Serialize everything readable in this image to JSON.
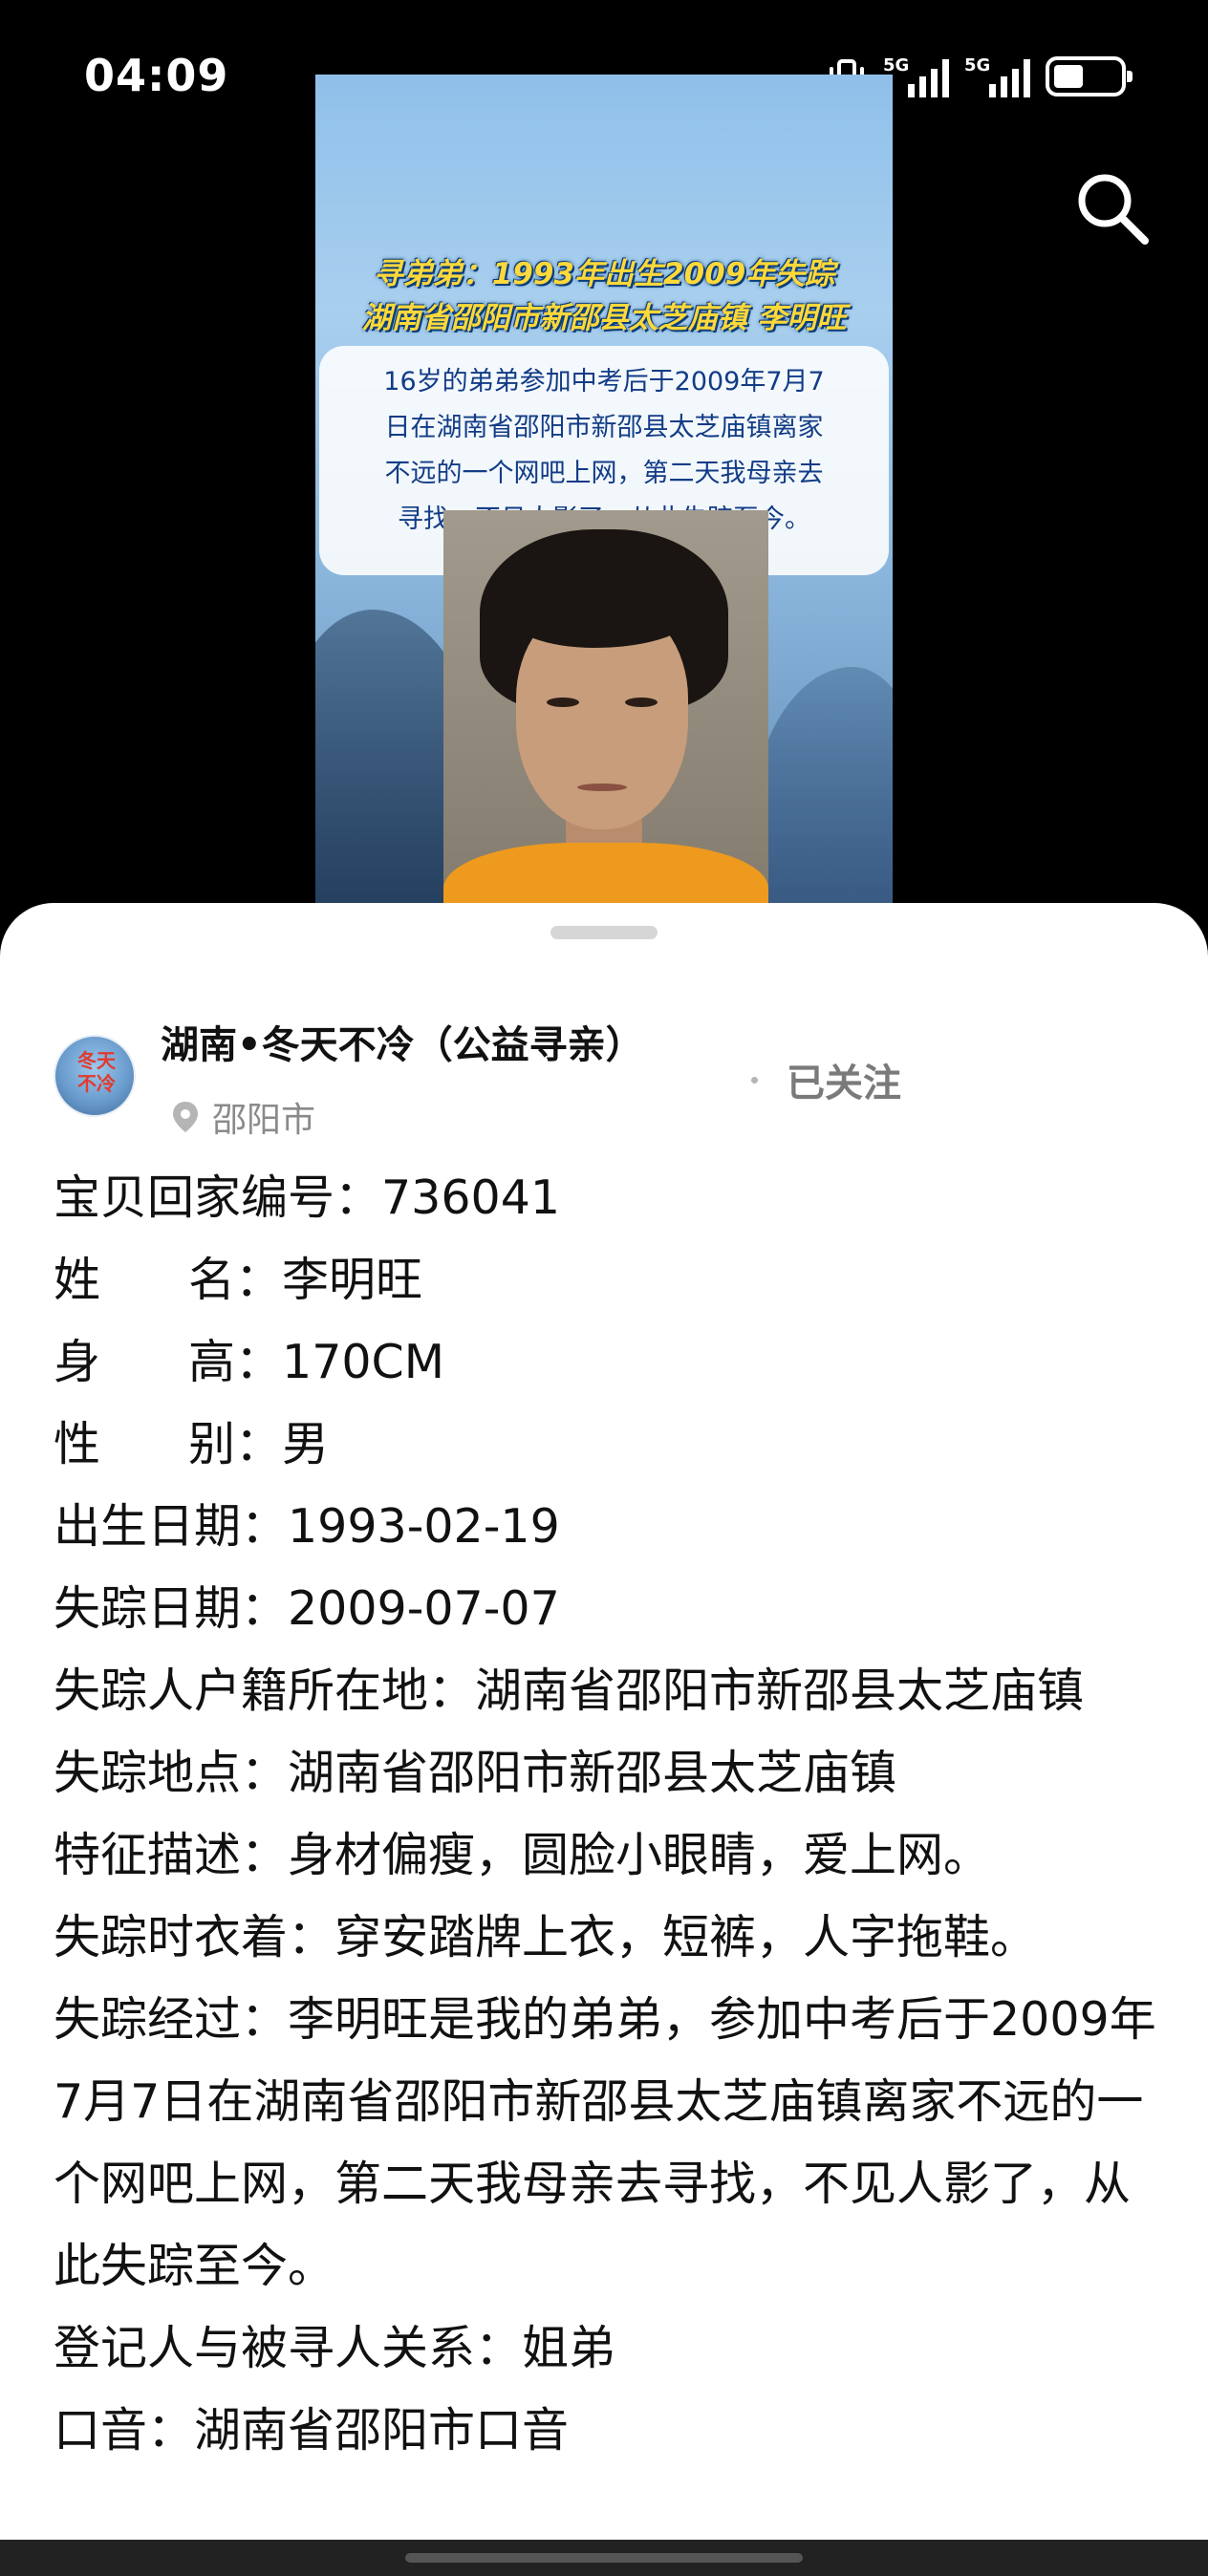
{
  "status_bar": {
    "time": "04:09",
    "network_1": "5G",
    "network_2": "5G",
    "battery_level": 0.45
  },
  "poster": {
    "title_line1": "寻弟弟：1993年出生2009年失踪",
    "title_line2": "湖南省邵阳市新邵县太芝庙镇 李明旺",
    "desc_line1": "16岁的弟弟参加中考后于2009年7月7",
    "desc_line2": "日在湖南省邵阳市新邵县太芝庙镇离家",
    "desc_line3": "不远的一个网吧上网，第二天我母亲去",
    "desc_line4": "寻找，不见人影了，从此失踪至今。"
  },
  "author": {
    "name": "湖南•冬天不冷（公益寻亲）",
    "avatar_text_1": "冬天",
    "avatar_text_2": "不冷",
    "location": "邵阳市",
    "follow_label": "已关注"
  },
  "info": {
    "case_no": "宝贝回家编号：736041",
    "name_label_a": "姓",
    "name_label_b": "名：",
    "name_value": "李明旺",
    "height_label_a": "身",
    "height_label_b": "高：",
    "height_value": "170CM",
    "gender_label_a": "性",
    "gender_label_b": "别：",
    "gender_value": "男",
    "birth": "出生日期：1993-02-19",
    "missing_date": "失踪日期：2009-07-07",
    "hukou": "失踪人户籍所在地：湖南省邵阳市新邵县太芝庙镇",
    "missing_place": "失踪地点：湖南省邵阳市新邵县太芝庙镇",
    "features": "特征描述：身材偏瘦，圆脸小眼睛，爱上网。",
    "clothing": "失踪时衣着：穿安踏牌上衣，短裤，人字拖鞋。",
    "story": "失踪经过：李明旺是我的弟弟，参加中考后于2009年7月7日在湖南省邵阳市新邵县太芝庙镇离家不远的一个网吧上网，第二天我母亲去寻找，不见人影了，从此失踪至今。",
    "relation": "登记人与被寻人关系：姐弟",
    "accent": "口音：湖南省邵阳市口音"
  },
  "colors": {
    "poster_title": "#ffd83a",
    "poster_desc_text": "#123c86",
    "shirt": "#ee9a1e"
  }
}
